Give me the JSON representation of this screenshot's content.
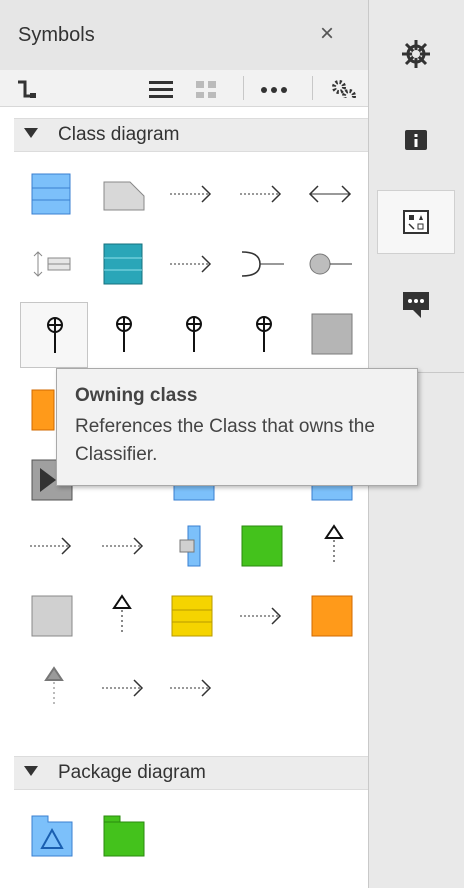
{
  "panel": {
    "title": "Symbols",
    "close_glyph": "×",
    "toolbar": [
      {
        "name": "connector-icon"
      },
      {
        "name": "list-view-icon"
      },
      {
        "name": "grid-view-icon"
      },
      {
        "name": "more-icon"
      },
      {
        "name": "settings-gears-icon"
      }
    ]
  },
  "sections": {
    "class_diagram": "Class diagram",
    "package_diagram": "Package diagram"
  },
  "tooltip": {
    "title": "Owning class",
    "body": "References the Class that owns the Classifier."
  },
  "rail": [
    {
      "name": "gear-icon",
      "active": false
    },
    {
      "name": "info-icon",
      "active": false
    },
    {
      "name": "symbols-icon",
      "active": true
    },
    {
      "name": "comment-icon",
      "active": false
    }
  ],
  "colors": {
    "blue": "#4aa3f0",
    "teal": "#2aa6b8",
    "green": "#44c21c",
    "yellow": "#f5d400",
    "orange": "#ff9a1a",
    "gray": "#b5b5b5"
  }
}
